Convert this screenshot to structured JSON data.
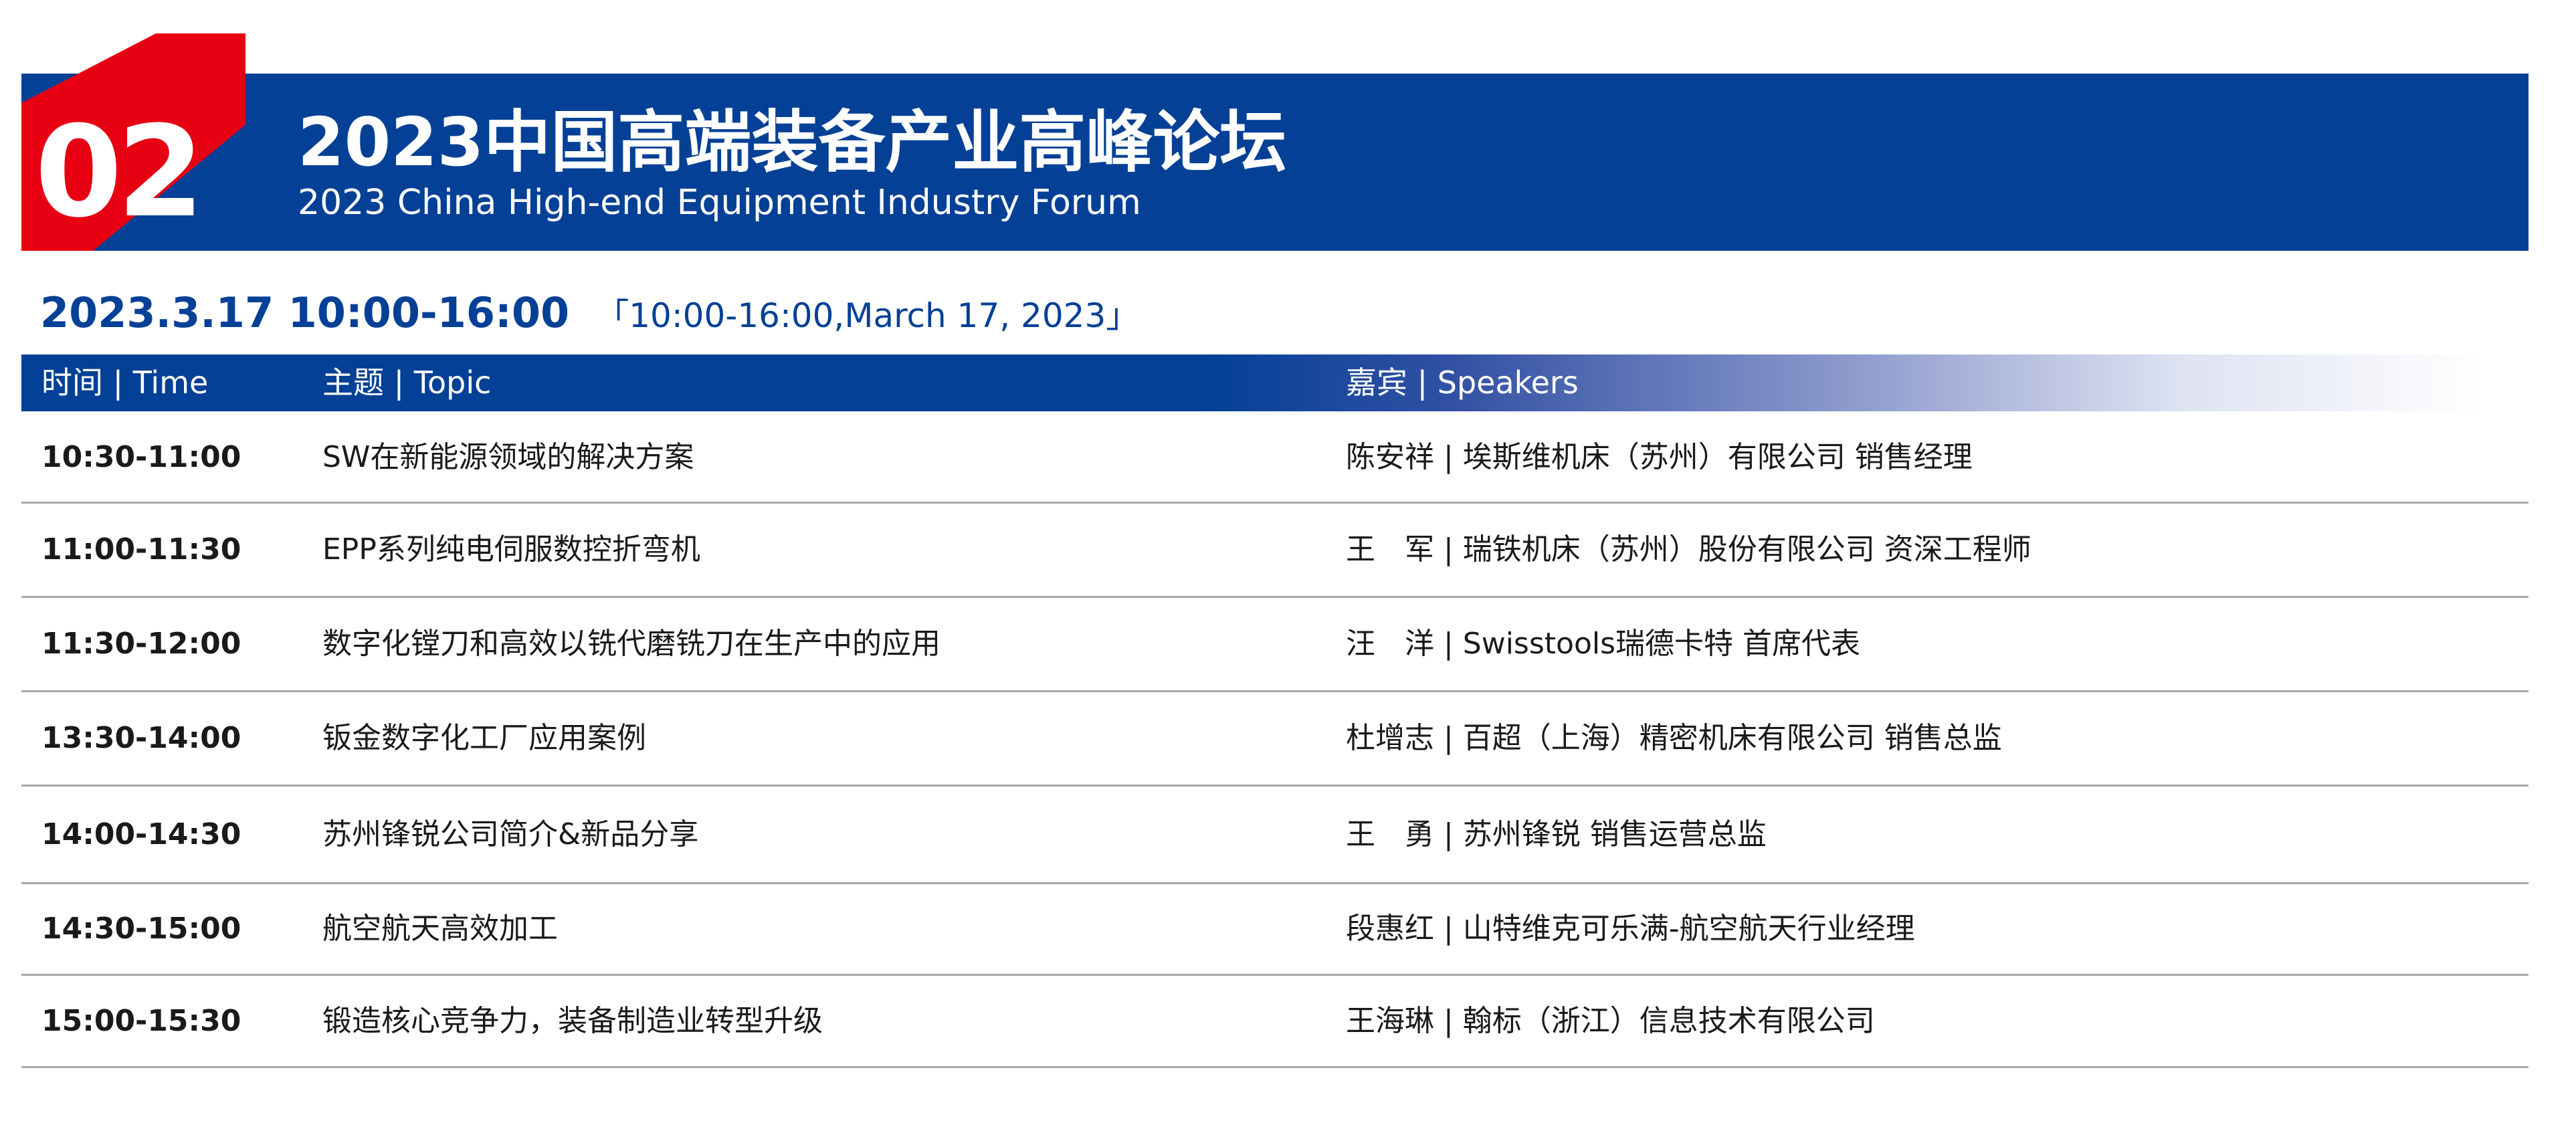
{
  "forum": {
    "number": "02",
    "title_cn": "2023中国高端装备产业高峰论坛",
    "title_en": "2023 China High-end Equipment Industry Forum",
    "date_main": "2023.3.17  10:00-16:00",
    "date_sub": "「10:00-16:00,March 17, 2023」"
  },
  "table": {
    "headers": {
      "time": "时间 | Time",
      "topic": "主题 | Topic",
      "speakers": "嘉宾 | Speakers"
    },
    "rows": [
      {
        "time": "10:30-11:00",
        "topic": "SW在新能源领域的解决方案",
        "speaker": "陈安祥 | 埃斯维机床（苏州）有限公司 销售经理"
      },
      {
        "time": "11:00-11:30",
        "topic": "EPP系列纯电伺服数控折弯机",
        "speaker": "王　军 | 瑞铁机床（苏州）股份有限公司 资深工程师"
      },
      {
        "time": "11:30-12:00",
        "topic": "数字化镗刀和高效以铣代磨铣刀在生产中的应用",
        "speaker": "汪　洋 | Swisstools瑞德卡特 首席代表"
      },
      {
        "time": "13:30-14:00",
        "topic": "钣金数字化工厂应用案例",
        "speaker": "杜增志 | 百超（上海）精密机床有限公司 销售总监"
      },
      {
        "time": "14:00-14:30",
        "topic": "苏州锋锐公司简介&新品分享",
        "speaker": "王　勇 | 苏州锋锐 销售运营总监"
      },
      {
        "time": "14:30-15:00",
        "topic": "航空航天高效加工",
        "speaker": "段惠红 | 山特维克可乐满-航空航天行业经理"
      },
      {
        "time": "15:00-15:30",
        "topic": "锻造核心竞争力，装备制造业转型升级",
        "speaker": "王海琳 | 翰标（浙江）信息技术有限公司"
      }
    ]
  },
  "colors": {
    "primary_blue": "#034096",
    "accent_red": "#e60012",
    "divider_gray": "#a8a8a8"
  }
}
